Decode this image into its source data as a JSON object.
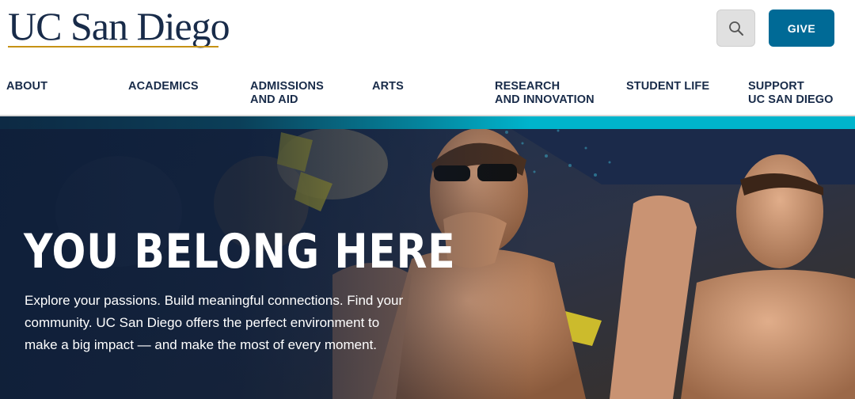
{
  "header": {
    "logo_text": "UC San Diego",
    "search_icon": "search-icon",
    "give_label": "GIVE"
  },
  "nav": {
    "items": [
      {
        "line1": "ABOUT",
        "line2": ""
      },
      {
        "line1": "ACADEMICS",
        "line2": ""
      },
      {
        "line1": "ADMISSIONS",
        "line2": "AND AID"
      },
      {
        "line1": "ARTS",
        "line2": ""
      },
      {
        "line1": "RESEARCH",
        "line2": "AND INNOVATION"
      },
      {
        "line1": "STUDENT LIFE",
        "line2": ""
      },
      {
        "line1": "SUPPORT",
        "line2": "UC SAN DIEGO"
      }
    ]
  },
  "hero": {
    "title": "YOU BELONG HERE",
    "body": "Explore your passions. Build meaningful connections. Find your community. UC San Diego offers the perfect environment to make a big impact — and make the most of every moment."
  },
  "colors": {
    "navy": "#182b49",
    "gold": "#c69214",
    "give_blue": "#006a96",
    "teal": "#00b4cc"
  }
}
